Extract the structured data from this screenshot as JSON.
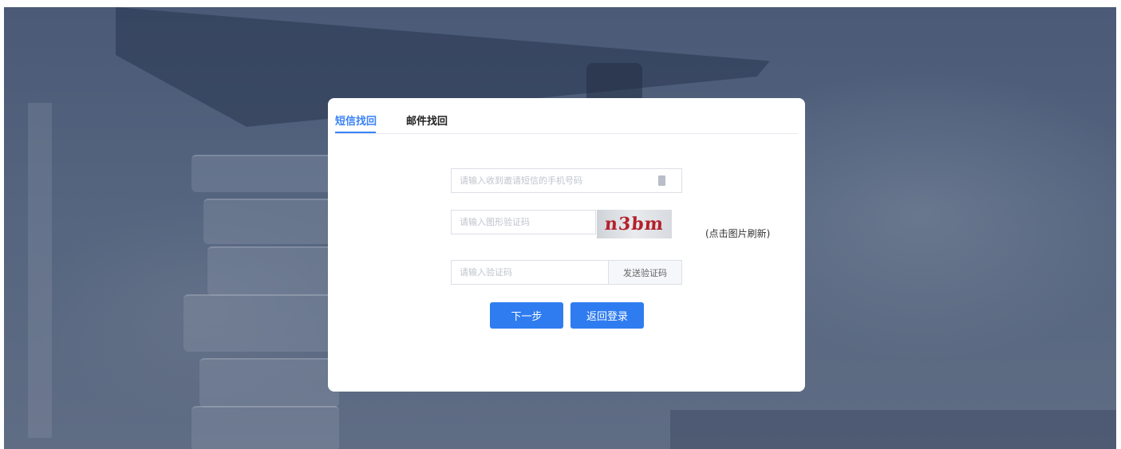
{
  "tabs": {
    "sms": "短信找回",
    "email": "邮件找回"
  },
  "form": {
    "phone_placeholder": "请输入收到邀请短信的手机号码",
    "captcha_placeholder": "请输入图形验证码",
    "captcha_text": "n3bm",
    "refresh_hint": "(点击图片刷新)",
    "code_placeholder": "请输入验证码",
    "send_code": "发送验证码"
  },
  "actions": {
    "next": "下一步",
    "back_to_login": "返回登录"
  },
  "icons": {
    "contact": "contact-card-icon"
  },
  "colors": {
    "accent": "#3b82f6",
    "button": "#2f7cf0"
  }
}
